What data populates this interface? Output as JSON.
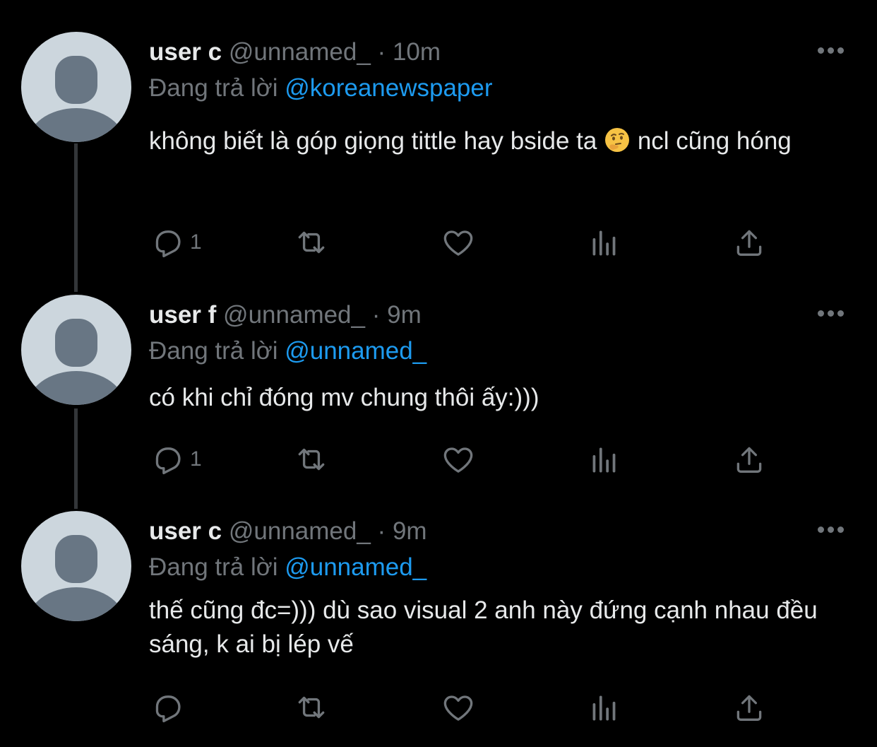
{
  "tweets": [
    {
      "name": "user c",
      "handle": "@unnamed_",
      "separator": "·",
      "time": "10m",
      "replying_prefix": "Đang trả lời",
      "replying_to": "@koreanewspaper",
      "text_before_emoji": "không biết là góp giọng tittle hay bside ta",
      "emoji": "thinking-face-emoji",
      "text_after_emoji": " ncl cũng hóng",
      "reply_count": "1",
      "retweet_count": "",
      "like_count": ""
    },
    {
      "name": "user f",
      "handle": "@unnamed_",
      "separator": "·",
      "time": "9m",
      "replying_prefix": "Đang trả lời",
      "replying_to": "@unnamed_",
      "text": "có khi chỉ đóng mv chung thôi ấy:)))",
      "reply_count": "1",
      "retweet_count": "",
      "like_count": ""
    },
    {
      "name": "user c",
      "handle": "@unnamed_",
      "separator": "·",
      "time": "9m",
      "replying_prefix": "Đang trả lời",
      "replying_to": "@unnamed_",
      "text": "thế cũng đc=))) dù sao visual 2 anh này đứng cạnh nhau đều sáng, k ai bị lép vế",
      "reply_count": "",
      "retweet_count": "",
      "like_count": ""
    }
  ],
  "icons": {
    "reply": "reply-icon",
    "retweet": "retweet-icon",
    "like": "heart-icon",
    "views": "analytics-icon",
    "share": "share-icon",
    "more": "more-icon"
  },
  "colors": {
    "background": "#000000",
    "text": "#e7e9ea",
    "muted": "#71767b",
    "link": "#1d9bf0",
    "avatar": "#ccd6dd",
    "avatar_figure": "#687684",
    "thread_line": "#333639"
  }
}
